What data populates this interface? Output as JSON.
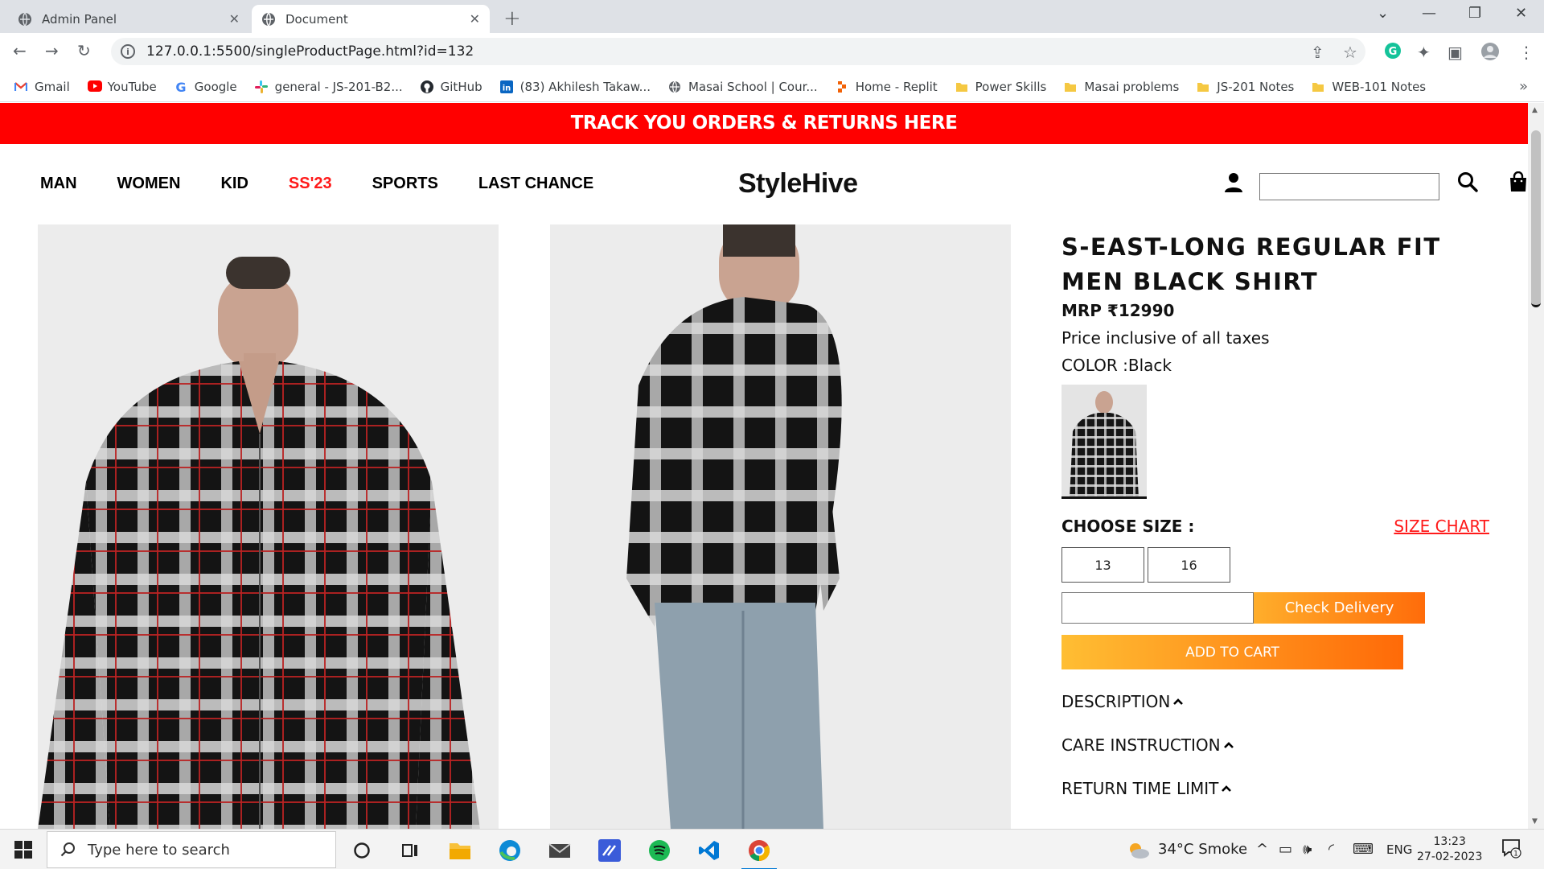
{
  "browser": {
    "tabs": [
      {
        "title": "Admin Panel",
        "active": false
      },
      {
        "title": "Document",
        "active": true
      }
    ],
    "url": "127.0.0.1:5500/singleProductPage.html?id=132",
    "bookmarks": [
      {
        "label": "Gmail",
        "icon": "gmail-icon"
      },
      {
        "label": "YouTube",
        "icon": "youtube-icon"
      },
      {
        "label": "Google",
        "icon": "google-icon"
      },
      {
        "label": "general - JS-201-B2...",
        "icon": "slack-icon"
      },
      {
        "label": "GitHub",
        "icon": "github-icon"
      },
      {
        "label": "(83) Akhilesh Takaw...",
        "icon": "linkedin-icon"
      },
      {
        "label": "Masai School | Cour...",
        "icon": "globe-icon"
      },
      {
        "label": "Home - Replit",
        "icon": "replit-icon"
      },
      {
        "label": "Power Skills",
        "icon": "folder-icon"
      },
      {
        "label": "Masai problems",
        "icon": "folder-icon"
      },
      {
        "label": "JS-201 Notes",
        "icon": "folder-icon"
      },
      {
        "label": "WEB-101 Notes",
        "icon": "folder-icon"
      }
    ]
  },
  "promo": {
    "text": "TRACK YOU ORDERS & RETURNS HERE"
  },
  "nav": {
    "links": [
      "MAN",
      "WOMEN",
      "KID",
      "SS'23",
      "SPORTS",
      "LAST CHANCE"
    ],
    "highlight_color": "#ff1a1a",
    "brand": "StyleHive",
    "search_value": ""
  },
  "product": {
    "title": "S-EAST-LONG REGULAR FIT MEN BLACK SHIRT",
    "mrp": "MRP ₹12990",
    "tax_note": "Price inclusive of all taxes",
    "color": "COLOR :Black",
    "choose_size": "CHOOSE SIZE :",
    "size_chart": "SIZE CHART",
    "sizes": [
      "13",
      "16"
    ],
    "pincode_value": "",
    "check_delivery": "Check Delivery",
    "add_to_cart": "ADD TO CART",
    "sections": [
      "DESCRIPTION",
      "CARE INSTRUCTION",
      "RETURN TIME LIMIT"
    ]
  },
  "colors": {
    "promo_red": "#ff0000",
    "accent_orange": "#ff8a1a"
  },
  "taskbar": {
    "search_placeholder": "Type here to search",
    "weather": "34°C  Smoke",
    "language": "ENG",
    "time": "13:23",
    "date": "27-02-2023",
    "notification_count": "1"
  }
}
